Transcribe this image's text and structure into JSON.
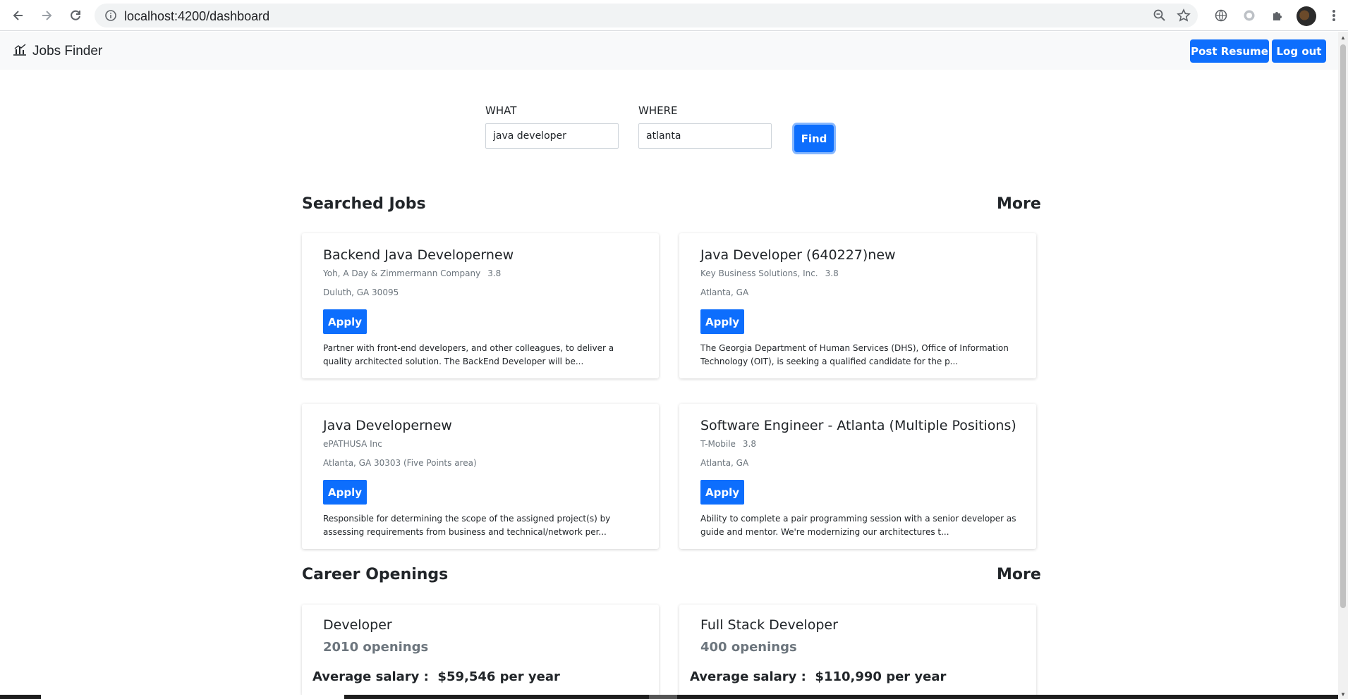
{
  "browser": {
    "url": "localhost:4200/dashboard"
  },
  "navbar": {
    "brand": "Jobs Finder",
    "post_resume_label": "Post Resume",
    "logout_label": "Log out"
  },
  "search": {
    "what_label": "WHAT",
    "what_value": "java developer",
    "where_label": "WHERE",
    "where_value": "atlanta",
    "find_label": "Find"
  },
  "searched_jobs": {
    "title": "Searched Jobs",
    "more_label": "More",
    "apply_label": "Apply",
    "jobs": [
      {
        "title": "Backend Java Developernew",
        "company": "Yoh, A Day & Zimmermann Company",
        "rating": "3.8",
        "location": "Duluth, GA 30095",
        "description": "Partner with front-end developers, and other colleagues, to deliver a quality architected solution. The BackEnd Developer will be..."
      },
      {
        "title": "Java Developer (640227)new",
        "company": "Key Business Solutions, Inc.",
        "rating": "3.8",
        "location": "Atlanta, GA",
        "description": "The Georgia Department of Human Services (DHS), Office of Information Technology (OIT), is seeking a qualified candidate for the p..."
      },
      {
        "title": "Java Developernew",
        "company": "ePATHUSA Inc",
        "rating": "",
        "location": "Atlanta, GA 30303 (Five Points area)",
        "description": "Responsible for determining the scope of the assigned project(s) by assessing requirements from business and technical/network per..."
      },
      {
        "title": "Software Engineer - Atlanta (Multiple Positions)",
        "company": "T-Mobile",
        "rating": "3.8",
        "location": "Atlanta, GA",
        "description": "Ability to complete a pair programming session with a senior developer as guide and mentor. We're modernizing our architectures t..."
      }
    ]
  },
  "career_openings": {
    "title": "Career Openings",
    "more_label": "More",
    "salary_prefix": "Average salary :",
    "items": [
      {
        "title": "Developer",
        "openings": "2010 openings",
        "salary": "$59,546 per year"
      },
      {
        "title": "Full Stack Developer",
        "openings": "400 openings",
        "salary": "$110,990 per year"
      }
    ]
  },
  "colors": {
    "primary": "#0d6efd",
    "navbar_bg": "#f8f9fa",
    "muted_text": "#6c757d"
  }
}
